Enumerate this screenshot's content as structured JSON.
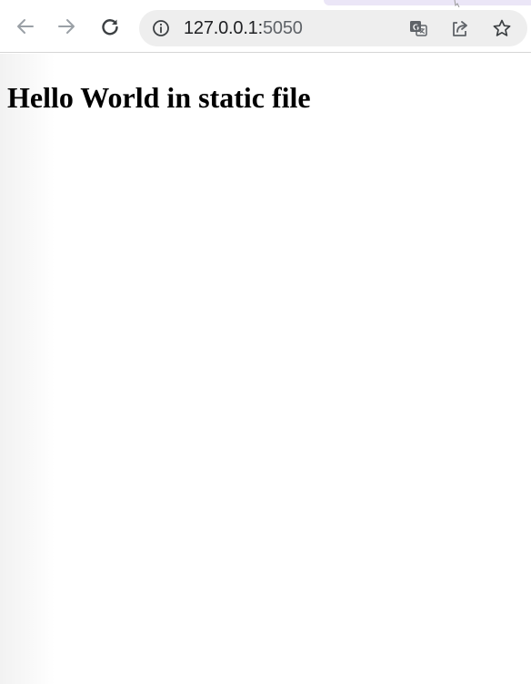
{
  "browser": {
    "address_bar": {
      "host": "127.0.0.1:",
      "port": "5050"
    },
    "icons": {
      "back": "back-arrow-icon",
      "forward": "forward-arrow-icon",
      "reload": "reload-icon",
      "site_info": "info-icon",
      "translate": "translate-icon",
      "share": "share-icon",
      "bookmark": "star-icon"
    },
    "colors": {
      "toolbar_background": "#ffffff",
      "omnibox_background": "#eeeeee",
      "icon_color": "#5f6368",
      "tab_strip_accent": "#ebe6f7"
    }
  },
  "page": {
    "heading": "Hello World in static file"
  }
}
